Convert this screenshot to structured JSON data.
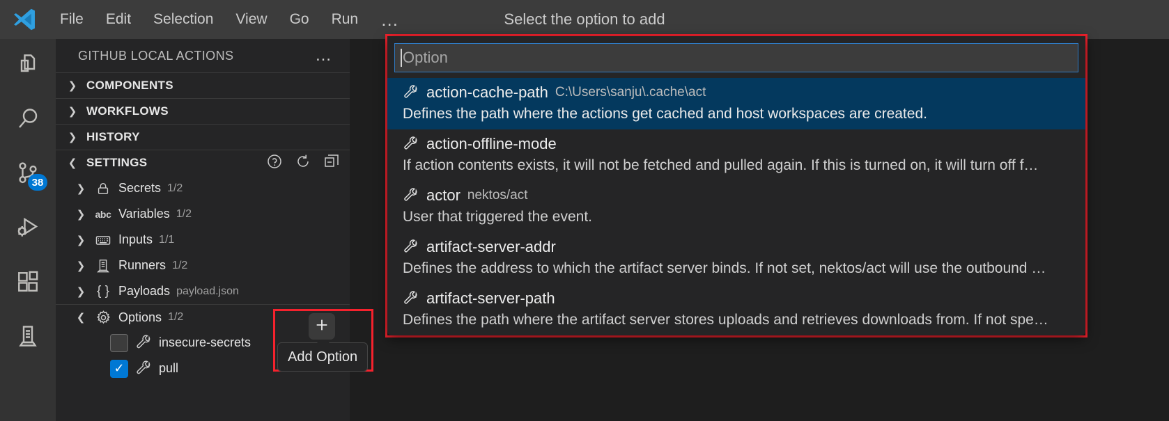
{
  "titlebar": {
    "logo_icon": "vscode-logo-icon",
    "center_title": "Select the option to add",
    "menu": [
      {
        "label": "File"
      },
      {
        "label": "Edit"
      },
      {
        "label": "Selection"
      },
      {
        "label": "View"
      },
      {
        "label": "Go"
      },
      {
        "label": "Run"
      }
    ],
    "more_label": "…"
  },
  "activitybar": {
    "items": [
      {
        "icon": "explorer-files-icon",
        "badge": ""
      },
      {
        "icon": "search-icon",
        "badge": ""
      },
      {
        "icon": "source-control-icon",
        "badge": "38"
      },
      {
        "icon": "run-and-debug-icon",
        "badge": ""
      },
      {
        "icon": "extensions-icon",
        "badge": ""
      },
      {
        "icon": "remote-server-icon",
        "badge": ""
      }
    ]
  },
  "sidebar": {
    "title": "GITHUB LOCAL ACTIONS",
    "more_label": "…",
    "sections": [
      {
        "label": "COMPONENTS",
        "expanded": false
      },
      {
        "label": "WORKFLOWS",
        "expanded": false
      },
      {
        "label": "HISTORY",
        "expanded": false
      },
      {
        "label": "SETTINGS",
        "expanded": true
      }
    ],
    "settings_actions": [
      {
        "icon": "help-icon"
      },
      {
        "icon": "refresh-icon"
      },
      {
        "icon": "collapse-all-icon"
      }
    ],
    "tree": [
      {
        "icon": "lock-icon",
        "name": "Secrets",
        "sub": "1/2",
        "expanded": false
      },
      {
        "icon": "abc-icon",
        "name": "Variables",
        "sub": "1/2",
        "expanded": false
      },
      {
        "icon": "keyboard-icon",
        "name": "Inputs",
        "sub": "1/1",
        "expanded": false
      },
      {
        "icon": "runner-icon",
        "name": "Runners",
        "sub": "1/2",
        "expanded": false
      },
      {
        "icon": "braces-icon",
        "name": "Payloads",
        "sub": "payload.json",
        "expanded": false
      },
      {
        "icon": "gear-icon",
        "name": "Options",
        "sub": "1/2",
        "expanded": true
      }
    ],
    "options": [
      {
        "icon": "wrench-icon",
        "name": "insecure-secrets",
        "checked": false
      },
      {
        "icon": "wrench-icon",
        "name": "pull",
        "checked": true
      }
    ]
  },
  "add_option": {
    "plus_icon": "plus-icon",
    "tooltip_label": "Add Option",
    "highlight_color": "#f5222d"
  },
  "quickpick": {
    "input_value": "",
    "input_placeholder": "Option",
    "highlight_color": "#f5222d",
    "selection_color": "#04395e",
    "items": [
      {
        "icon": "wrench-icon",
        "label": "action-cache-path",
        "detail": "C:\\Users\\sanju\\.cache\\act",
        "description": "Defines the path where the actions get cached and host workspaces are created.",
        "selected": true
      },
      {
        "icon": "wrench-icon",
        "label": "action-offline-mode",
        "detail": "",
        "description": "If action contents exists, it will not be fetched and pulled again. If this is turned on, it will turn off f…",
        "selected": false
      },
      {
        "icon": "wrench-icon",
        "label": "actor",
        "detail": "nektos/act",
        "description": "User that triggered the event.",
        "selected": false
      },
      {
        "icon": "wrench-icon",
        "label": "artifact-server-addr",
        "detail": "",
        "description": "Defines the address to which the artifact server binds. If not set, nektos/act will use the outbound …",
        "selected": false
      },
      {
        "icon": "wrench-icon",
        "label": "artifact-server-path",
        "detail": "",
        "description": "Defines the path where the artifact server stores uploads and retrieves downloads from. If not spe…",
        "selected": false
      }
    ]
  }
}
